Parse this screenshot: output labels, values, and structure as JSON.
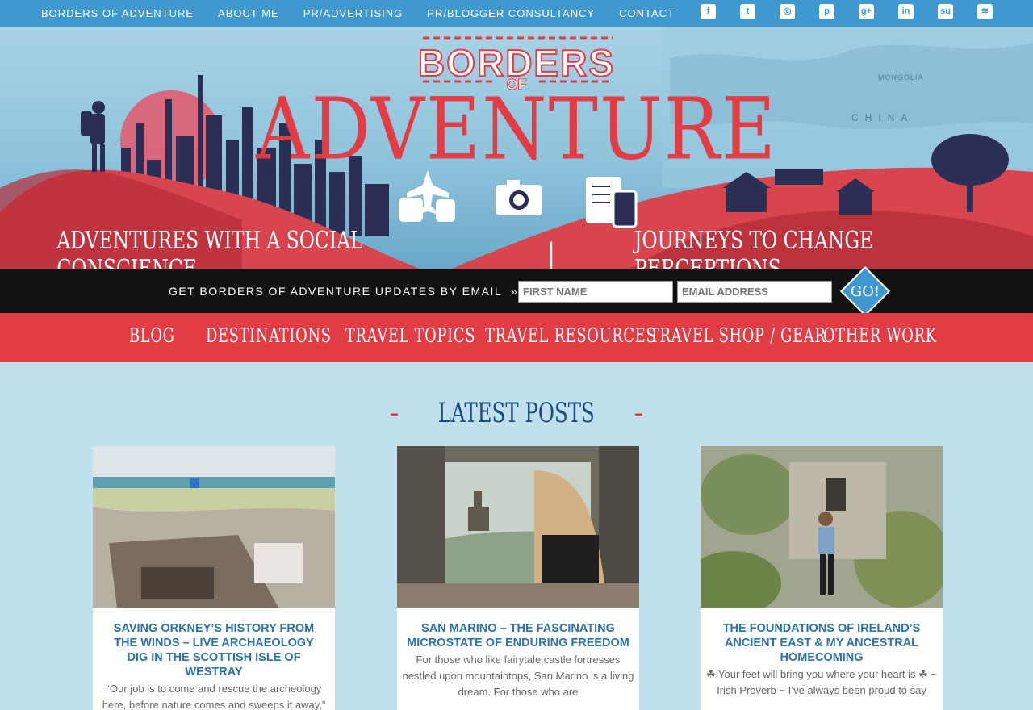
{
  "topbar": {
    "links": [
      "BORDERS OF ADVENTURE",
      "ABOUT ME",
      "PR/ADVERTISING",
      "PR/BLOGGER CONSULTANCY",
      "CONTACT"
    ],
    "social_icons": [
      "facebook-icon",
      "twitter-icon",
      "instagram-icon",
      "pinterest-icon",
      "google-plus-icon",
      "linkedin-icon",
      "stumbleupon-icon",
      "rss-icon"
    ]
  },
  "hero": {
    "logo_top": "BORDERS",
    "logo_of": "OF",
    "logo_main": "ADVENTURE",
    "tagline_left": "Adventures with a social conscience",
    "tagline_sep": "|",
    "tagline_right": "Journeys to change perceptions",
    "map_label": "CHINA",
    "map_label_small": "MONGOLIA"
  },
  "signup": {
    "label": "GET BORDERS OF ADVENTURE UPDATES BY EMAIL",
    "first_name_placeholder": "FIRST NAME",
    "email_placeholder": "EMAIL ADDRESS",
    "go_label": "GO!"
  },
  "nav": {
    "items": [
      "Blog",
      "Destinations",
      "Travel Topics",
      "Travel Resources",
      "Travel Shop / Gear",
      "Other Work"
    ]
  },
  "latest": {
    "dash": "-",
    "heading": "Latest Posts"
  },
  "posts": [
    {
      "title": "SAVING ORKNEY’S HISTORY FROM THE WINDS – LIVE ARCHAEOLOGY DIG IN THE SCOTTISH ISLE OF WESTRAY",
      "excerpt": "“Our job is to come and rescue the archeology here, before nature comes and sweeps it away,”"
    },
    {
      "title": "SAN MARINO – THE FASCINATING MICROSTATE OF ENDURING FREEDOM",
      "excerpt": "For those who like fairytale castle fortresses nestled upon mountaintops, San Marino is a living dream. For those who are"
    },
    {
      "title": "THE FOUNDATIONS OF IRELAND’S ANCIENT EAST & MY ANCESTRAL HOMECOMING",
      "excerpt": "☘ Your feet will bring you where your heart is ☘ ~ Irish Proverb ~ I’ve always been proud to say"
    }
  ],
  "colors": {
    "topbar": "#3f98cf",
    "accent_red": "#e23c45",
    "page_bg": "#bfe0ec",
    "heading_blue": "#1d4c7a",
    "title_blue": "#2a72a8"
  }
}
